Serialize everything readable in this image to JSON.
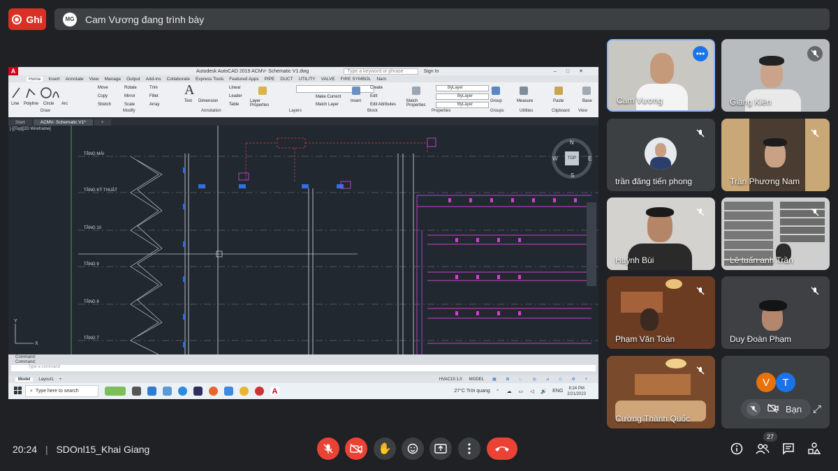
{
  "top": {
    "record_label": "Ghi",
    "presenter_initials": "MG",
    "presenting_text": "Cam Vương đang trình bày"
  },
  "autocad": {
    "title": "Autodesk AutoCAD 2019   ACMV- Schematic V1.dwg",
    "search_placeholder": "Type a keyword or phrase",
    "sign_in": "Sign In",
    "ribbon_tabs": [
      "Home",
      "Insert",
      "Annotate",
      "View",
      "Manage",
      "Output",
      "Add-ins",
      "Collaborate",
      "Express Tools",
      "Featured Apps",
      "PIPE",
      "DUCT",
      "UTILITY",
      "VALVE",
      "FIRE SYMBOL",
      "Nam"
    ],
    "draw_tools": [
      "Line",
      "Polyline",
      "Circle",
      "Arc"
    ],
    "modify_tools": [
      "Move",
      "Rotate",
      "Trim",
      "Copy",
      "Mirror",
      "Fillet",
      "Stretch",
      "Scale",
      "Array"
    ],
    "annotation_tools": [
      "Text",
      "Dimension",
      "Linear",
      "Leader",
      "Table"
    ],
    "layer_tools": [
      "Layer Properties",
      "Make Current",
      "Match Layer"
    ],
    "block_tools": [
      "Insert",
      "Create",
      "Edit",
      "Edit Attributes"
    ],
    "properties_tools": [
      "Match Properties",
      "ByLayer",
      "ByLayer",
      "ByLayer"
    ],
    "other_tools": [
      "Group",
      "Measure",
      "Paste",
      "Base"
    ],
    "panel_labels": [
      "Draw",
      "Modify",
      "Annotation",
      "Layers",
      "Block",
      "Properties",
      "Groups",
      "Utilities",
      "Clipboard",
      "View"
    ],
    "file_tabs": [
      "Start",
      "ACMV- Schematic V1*"
    ],
    "viewport_label": "[-][Top][2D Wireframe]",
    "floors": [
      "TẦNG MÁI",
      "TẦNG KỸ THUẬT",
      "TẦNG 10",
      "TẦNG 9",
      "TẦNG 8",
      "TẦNG 7"
    ],
    "compass": {
      "n": "N",
      "s": "S",
      "e": "E",
      "w": "W",
      "top": "TOP"
    },
    "command_lines": [
      "Command:",
      "Command:"
    ],
    "command_placeholder": "Type a command",
    "layout_tabs": [
      "Model",
      "Layout1"
    ],
    "status_scale": "HVAC15:1,0",
    "status_model": "MODEL",
    "taskbar_search": "Type here to search",
    "weather": "27°C  Trời quang",
    "lang": "ENG",
    "clock_time": "8:24 PM",
    "clock_date": "2/21/2023"
  },
  "participants": [
    {
      "name": "Cam Vương",
      "muted": false,
      "highlight": true,
      "icon": "more-options-icon"
    },
    {
      "name": "Giang Kiên",
      "muted": true
    },
    {
      "name": "trần đăng tiến phong",
      "muted": true
    },
    {
      "name": "Trần Phương Nam",
      "muted": true
    },
    {
      "name": "Huỳnh Bùi",
      "muted": true
    },
    {
      "name": "Lê tuấn anh Trần",
      "muted": true
    },
    {
      "name": "Phạm Văn Toàn",
      "muted": true
    },
    {
      "name": "Duy Đoàn Phạm",
      "muted": true
    },
    {
      "name": "Cường Thành Quốc",
      "muted": true
    }
  ],
  "self_tile": {
    "avatars": [
      "V",
      "T"
    ],
    "avatar_colors": [
      "#e8710a",
      "#1a73e8"
    ],
    "label": "Bạn"
  },
  "bottom": {
    "time": "20:24",
    "meeting_name": "SDOnl15_Khai Giang",
    "people_count": "27"
  },
  "colors": {
    "background": "#202124",
    "tile": "#3c4043",
    "red": "#ea4335",
    "highlight": "#8ab4f8"
  }
}
